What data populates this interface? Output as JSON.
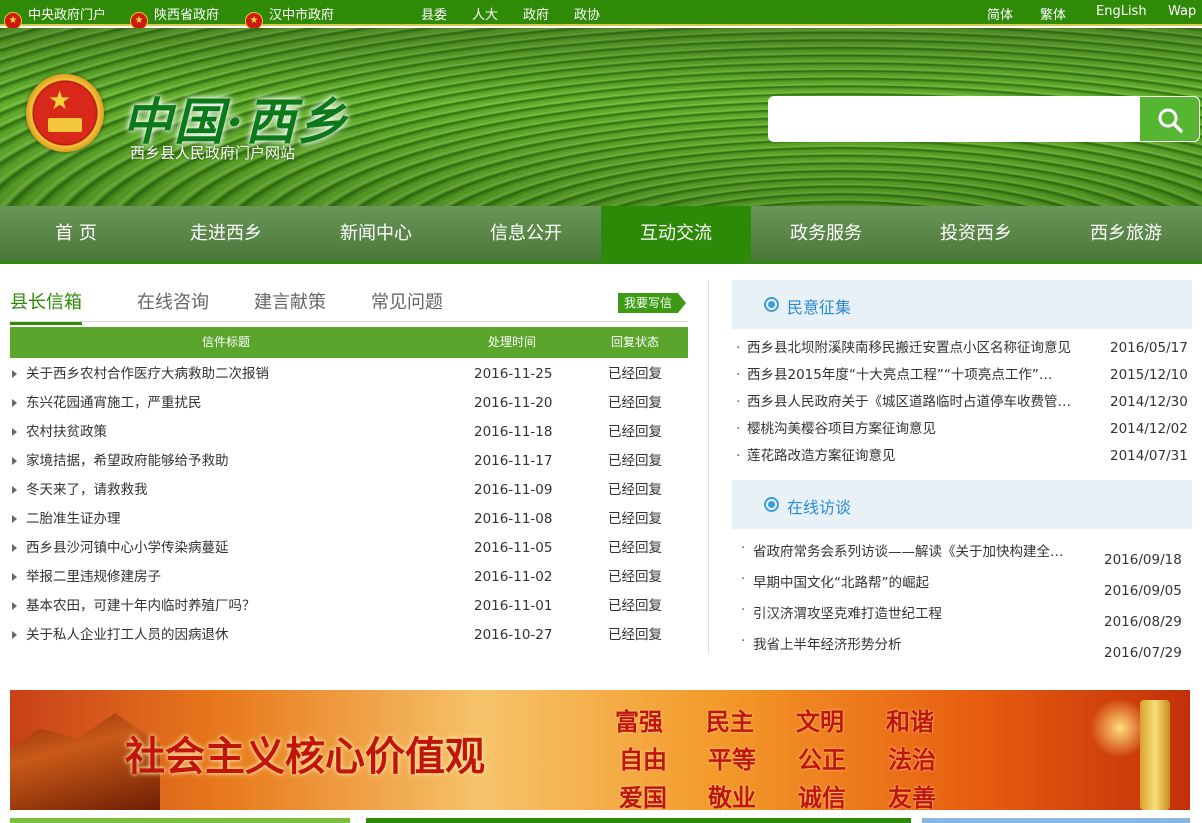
{
  "topbar": {
    "left_links": [
      "中央政府门户",
      "陕西省政府",
      "汉中市政府"
    ],
    "mid_links": [
      "县委",
      "人大",
      "政府",
      "政协"
    ],
    "right_links": [
      "简体",
      "繁体",
      "EngLish",
      "Wap"
    ]
  },
  "header": {
    "logo_title": "中国·西乡",
    "logo_subtitle": "西乡县人民政府门户网站",
    "search_placeholder": ""
  },
  "nav": {
    "items": [
      "首 页",
      "走进西乡",
      "新闻中心",
      "信息公开",
      "互动交流",
      "政务服务",
      "投资西乡",
      "西乡旅游"
    ],
    "active": "互动交流"
  },
  "mailbox": {
    "tabs": [
      "县长信箱",
      "在线咨询",
      "建言献策",
      "常见问题"
    ],
    "active_tab": "县长信箱",
    "write_button": "我要写信",
    "columns": [
      "信件标题",
      "处理时间",
      "回复状态"
    ],
    "rows": [
      {
        "title": "关于西乡农村合作医疗大病救助二次报销",
        "date": "2016-11-25",
        "status": "已经回复"
      },
      {
        "title": "东兴花园通宵施工，严重扰民",
        "date": "2016-11-20",
        "status": "已经回复"
      },
      {
        "title": "农村扶贫政策",
        "date": "2016-11-18",
        "status": "已经回复"
      },
      {
        "title": "家境拮据，希望政府能够给予救助",
        "date": "2016-11-17",
        "status": "已经回复"
      },
      {
        "title": "冬天来了，请救救我",
        "date": "2016-11-09",
        "status": "已经回复"
      },
      {
        "title": "二胎准生证办理",
        "date": "2016-11-08",
        "status": "已经回复"
      },
      {
        "title": "西乡县沙河镇中心小学传染病蔓延",
        "date": "2016-11-05",
        "status": "已经回复"
      },
      {
        "title": "举报二里违规修建房子",
        "date": "2016-11-02",
        "status": "已经回复"
      },
      {
        "title": "基本农田，可建十年内临时养殖厂吗？",
        "date": "2016-11-01",
        "status": "已经回复"
      },
      {
        "title": "关于私人企业打工人员的因病退休",
        "date": "2016-10-27",
        "status": "已经回复"
      }
    ]
  },
  "opinion": {
    "heading": "民意征集",
    "items": [
      {
        "title": "西乡县北坝附溪陕南移民搬迁安置点小区名称征询意见",
        "date": "2016/05/17"
      },
      {
        "title": "西乡县2015年度“十大亮点工程”“十项亮点工作”…",
        "date": "2015/12/10"
      },
      {
        "title": "西乡县人民政府关于《城区道路临时占道停车收费管…",
        "date": "2014/12/30"
      },
      {
        "title": "樱桃沟美樱谷项目方案征询意见",
        "date": "2014/12/02"
      },
      {
        "title": "莲花路改造方案征询意见",
        "date": "2014/07/31"
      }
    ]
  },
  "interview": {
    "heading": "在线访谈",
    "items": [
      {
        "title": "省政府常务会系列访谈——解读《关于加快构建全…",
        "date": "2016/09/18"
      },
      {
        "title": "早期中国文化“北路帮”的崛起",
        "date": "2016/09/05"
      },
      {
        "title": "引汉济渭攻坚克难打造世纪工程",
        "date": "2016/08/29"
      },
      {
        "title": "我省上半年经济形势分析",
        "date": "2016/07/29"
      }
    ]
  },
  "ad_banner": {
    "slogan": "社会主义核心价值观",
    "values": [
      "富强",
      "民主",
      "文明",
      "和谐",
      "自由",
      "平等",
      "公正",
      "法治",
      "爱国",
      "敬业",
      "诚信",
      "友善"
    ]
  },
  "colors": {
    "primary_green": "#2f8a08",
    "table_header": "#5aa52c",
    "section_blue": "#2c8ad0"
  }
}
